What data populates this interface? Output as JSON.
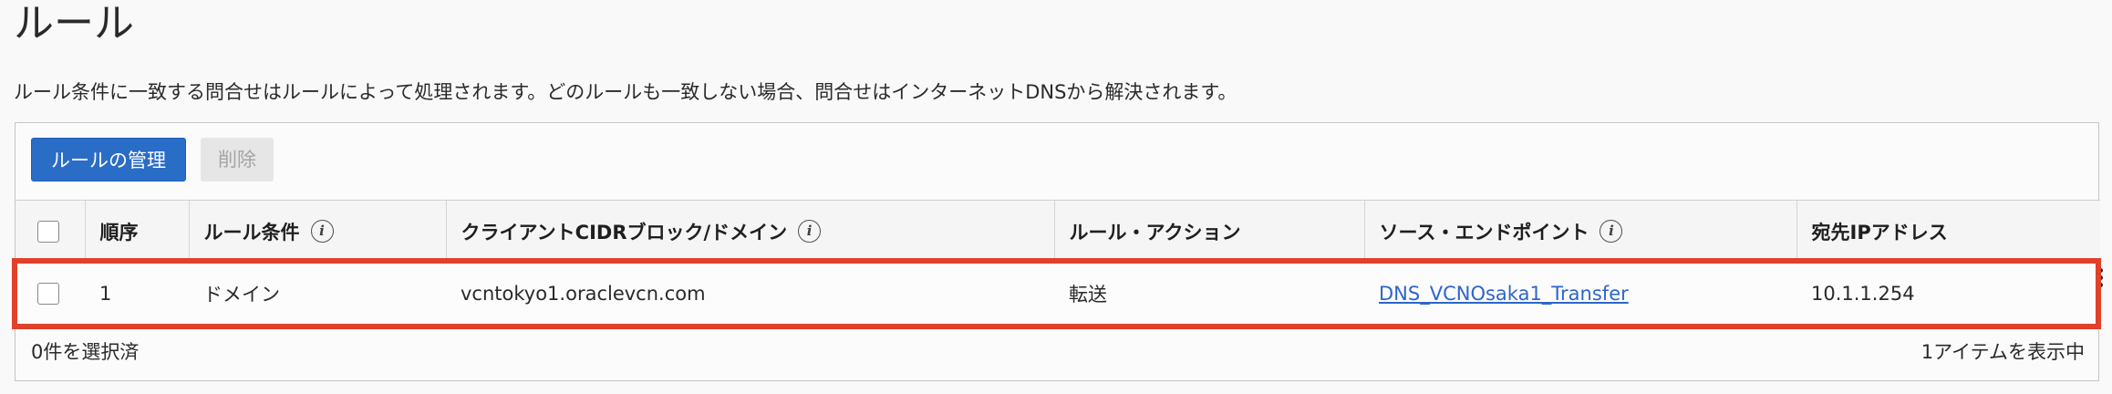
{
  "page": {
    "title": "ルール",
    "description": "ルール条件に一致する問合せはルールによって処理されます。どのルールも一致しない場合、問合せはインターネットDNSから解決されます。"
  },
  "toolbar": {
    "manage_label": "ルールの管理",
    "delete_label": "削除"
  },
  "table": {
    "headers": {
      "order": "順序",
      "condition": "ルール条件",
      "client": "クライアントCIDRブロック/ドメイン",
      "action": "ルール・アクション",
      "endpoint": "ソース・エンドポイント",
      "destination": "宛先IPアドレス"
    },
    "rows": [
      {
        "order": "1",
        "condition": "ドメイン",
        "client": "vcntokyo1.oraclevcn.com",
        "action": "転送",
        "endpoint": "DNS_VCNOsaka1_Transfer",
        "destination": "10.1.1.254"
      }
    ]
  },
  "footer": {
    "selected": "0件を選択済",
    "count": "1アイテムを表示中"
  },
  "icons": {
    "info": "info-icon",
    "row_actions": "kebab-menu-icon"
  },
  "colors": {
    "primary_button": "#2a6dc7",
    "link": "#2d66c9",
    "highlight": "#e1402a"
  }
}
